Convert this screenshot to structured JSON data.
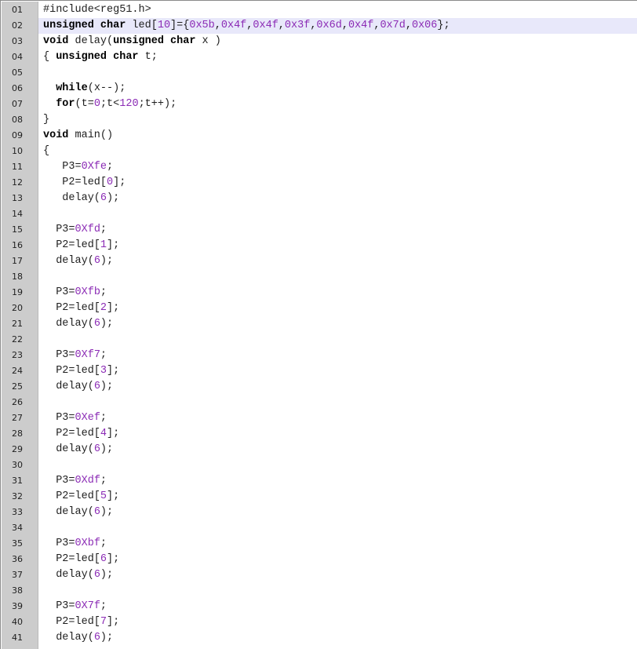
{
  "editor": {
    "highlighted_line": "02",
    "lines": [
      {
        "n": "01",
        "tokens": [
          {
            "t": "#include<reg51.h>",
            "c": "pre"
          }
        ]
      },
      {
        "n": "02",
        "tokens": [
          {
            "t": "unsigned char",
            "c": "kw"
          },
          {
            "t": " led[",
            "c": ""
          },
          {
            "t": "10",
            "c": "num"
          },
          {
            "t": "]={",
            "c": ""
          },
          {
            "t": "0x5b",
            "c": "num"
          },
          {
            "t": ",",
            "c": ""
          },
          {
            "t": "0x4f",
            "c": "num"
          },
          {
            "t": ",",
            "c": ""
          },
          {
            "t": "0x4f",
            "c": "num"
          },
          {
            "t": ",",
            "c": ""
          },
          {
            "t": "0x3f",
            "c": "num"
          },
          {
            "t": ",",
            "c": ""
          },
          {
            "t": "0x6d",
            "c": "num"
          },
          {
            "t": ",",
            "c": ""
          },
          {
            "t": "0x4f",
            "c": "num"
          },
          {
            "t": ",",
            "c": ""
          },
          {
            "t": "0x7d",
            "c": "num"
          },
          {
            "t": ",",
            "c": ""
          },
          {
            "t": "0x06",
            "c": "num"
          },
          {
            "t": "};",
            "c": ""
          }
        ]
      },
      {
        "n": "03",
        "tokens": [
          {
            "t": "void",
            "c": "kw"
          },
          {
            "t": " delay(",
            "c": ""
          },
          {
            "t": "unsigned char",
            "c": "kw"
          },
          {
            "t": " x )",
            "c": ""
          }
        ]
      },
      {
        "n": "04",
        "tokens": [
          {
            "t": "{ ",
            "c": ""
          },
          {
            "t": "unsigned char",
            "c": "kw"
          },
          {
            "t": " t;",
            "c": ""
          }
        ]
      },
      {
        "n": "05",
        "tokens": []
      },
      {
        "n": "06",
        "tokens": [
          {
            "t": "  ",
            "c": ""
          },
          {
            "t": "while",
            "c": "kw"
          },
          {
            "t": "(x--);",
            "c": ""
          }
        ]
      },
      {
        "n": "07",
        "tokens": [
          {
            "t": "  ",
            "c": ""
          },
          {
            "t": "for",
            "c": "kw"
          },
          {
            "t": "(t=",
            "c": ""
          },
          {
            "t": "0",
            "c": "num"
          },
          {
            "t": ";t<",
            "c": ""
          },
          {
            "t": "120",
            "c": "num"
          },
          {
            "t": ";t++);",
            "c": ""
          }
        ]
      },
      {
        "n": "08",
        "tokens": [
          {
            "t": "}",
            "c": ""
          }
        ]
      },
      {
        "n": "09",
        "tokens": [
          {
            "t": "void",
            "c": "kw"
          },
          {
            "t": " main()",
            "c": ""
          }
        ]
      },
      {
        "n": "10",
        "tokens": [
          {
            "t": "{",
            "c": ""
          }
        ]
      },
      {
        "n": "11",
        "tokens": [
          {
            "t": "   P3=",
            "c": ""
          },
          {
            "t": "0Xfe",
            "c": "num"
          },
          {
            "t": ";",
            "c": ""
          }
        ]
      },
      {
        "n": "12",
        "tokens": [
          {
            "t": "   P2=led[",
            "c": ""
          },
          {
            "t": "0",
            "c": "num"
          },
          {
            "t": "];",
            "c": ""
          }
        ]
      },
      {
        "n": "13",
        "tokens": [
          {
            "t": "   delay(",
            "c": ""
          },
          {
            "t": "6",
            "c": "num"
          },
          {
            "t": ");",
            "c": ""
          }
        ]
      },
      {
        "n": "14",
        "tokens": []
      },
      {
        "n": "15",
        "tokens": [
          {
            "t": "  P3=",
            "c": ""
          },
          {
            "t": "0Xfd",
            "c": "num"
          },
          {
            "t": ";",
            "c": ""
          }
        ]
      },
      {
        "n": "16",
        "tokens": [
          {
            "t": "  P2=led[",
            "c": ""
          },
          {
            "t": "1",
            "c": "num"
          },
          {
            "t": "];",
            "c": ""
          }
        ]
      },
      {
        "n": "17",
        "tokens": [
          {
            "t": "  delay(",
            "c": ""
          },
          {
            "t": "6",
            "c": "num"
          },
          {
            "t": ");",
            "c": ""
          }
        ]
      },
      {
        "n": "18",
        "tokens": []
      },
      {
        "n": "19",
        "tokens": [
          {
            "t": "  P3=",
            "c": ""
          },
          {
            "t": "0Xfb",
            "c": "num"
          },
          {
            "t": ";",
            "c": ""
          }
        ]
      },
      {
        "n": "20",
        "tokens": [
          {
            "t": "  P2=led[",
            "c": ""
          },
          {
            "t": "2",
            "c": "num"
          },
          {
            "t": "];",
            "c": ""
          }
        ]
      },
      {
        "n": "21",
        "tokens": [
          {
            "t": "  delay(",
            "c": ""
          },
          {
            "t": "6",
            "c": "num"
          },
          {
            "t": ");",
            "c": ""
          }
        ]
      },
      {
        "n": "22",
        "tokens": []
      },
      {
        "n": "23",
        "tokens": [
          {
            "t": "  P3=",
            "c": ""
          },
          {
            "t": "0Xf7",
            "c": "num"
          },
          {
            "t": ";",
            "c": ""
          }
        ]
      },
      {
        "n": "24",
        "tokens": [
          {
            "t": "  P2=led[",
            "c": ""
          },
          {
            "t": "3",
            "c": "num"
          },
          {
            "t": "];",
            "c": ""
          }
        ]
      },
      {
        "n": "25",
        "tokens": [
          {
            "t": "  delay(",
            "c": ""
          },
          {
            "t": "6",
            "c": "num"
          },
          {
            "t": ");",
            "c": ""
          }
        ]
      },
      {
        "n": "26",
        "tokens": []
      },
      {
        "n": "27",
        "tokens": [
          {
            "t": "  P3=",
            "c": ""
          },
          {
            "t": "0Xef",
            "c": "num"
          },
          {
            "t": ";",
            "c": ""
          }
        ]
      },
      {
        "n": "28",
        "tokens": [
          {
            "t": "  P2=led[",
            "c": ""
          },
          {
            "t": "4",
            "c": "num"
          },
          {
            "t": "];",
            "c": ""
          }
        ]
      },
      {
        "n": "29",
        "tokens": [
          {
            "t": "  delay(",
            "c": ""
          },
          {
            "t": "6",
            "c": "num"
          },
          {
            "t": ");",
            "c": ""
          }
        ]
      },
      {
        "n": "30",
        "tokens": []
      },
      {
        "n": "31",
        "tokens": [
          {
            "t": "  P3=",
            "c": ""
          },
          {
            "t": "0Xdf",
            "c": "num"
          },
          {
            "t": ";",
            "c": ""
          }
        ]
      },
      {
        "n": "32",
        "tokens": [
          {
            "t": "  P2=led[",
            "c": ""
          },
          {
            "t": "5",
            "c": "num"
          },
          {
            "t": "];",
            "c": ""
          }
        ]
      },
      {
        "n": "33",
        "tokens": [
          {
            "t": "  delay(",
            "c": ""
          },
          {
            "t": "6",
            "c": "num"
          },
          {
            "t": ");",
            "c": ""
          }
        ]
      },
      {
        "n": "34",
        "tokens": []
      },
      {
        "n": "35",
        "tokens": [
          {
            "t": "  P3=",
            "c": ""
          },
          {
            "t": "0Xbf",
            "c": "num"
          },
          {
            "t": ";",
            "c": ""
          }
        ]
      },
      {
        "n": "36",
        "tokens": [
          {
            "t": "  P2=led[",
            "c": ""
          },
          {
            "t": "6",
            "c": "num"
          },
          {
            "t": "];",
            "c": ""
          }
        ]
      },
      {
        "n": "37",
        "tokens": [
          {
            "t": "  delay(",
            "c": ""
          },
          {
            "t": "6",
            "c": "num"
          },
          {
            "t": ");",
            "c": ""
          }
        ]
      },
      {
        "n": "38",
        "tokens": []
      },
      {
        "n": "39",
        "tokens": [
          {
            "t": "  P3=",
            "c": ""
          },
          {
            "t": "0X7f",
            "c": "num"
          },
          {
            "t": ";",
            "c": ""
          }
        ]
      },
      {
        "n": "40",
        "tokens": [
          {
            "t": "  P2=led[",
            "c": ""
          },
          {
            "t": "7",
            "c": "num"
          },
          {
            "t": "];",
            "c": ""
          }
        ]
      },
      {
        "n": "41",
        "tokens": [
          {
            "t": "  delay(",
            "c": ""
          },
          {
            "t": "6",
            "c": "num"
          },
          {
            "t": ");",
            "c": ""
          }
        ]
      }
    ]
  },
  "colors": {
    "number": "#8b2bb5",
    "keyword": "#000000",
    "highlight": "#e8e8fa",
    "gutter": "#d7d7d7"
  }
}
